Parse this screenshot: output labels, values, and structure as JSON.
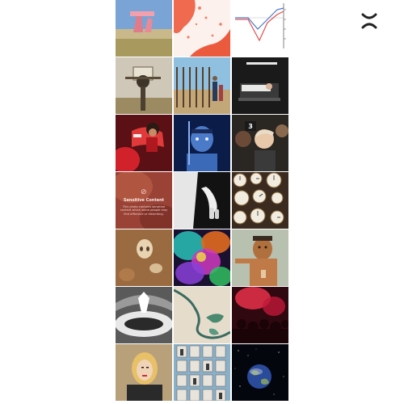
{
  "brand": {
    "logo_icon": "x-logo-icon"
  },
  "grid": {
    "sensitive_tile": {
      "icon": "eye-slash-icon",
      "title": "Sensitive Content",
      "description": "This photo contains sensitive content which some people may find offensive or disturbing."
    }
  }
}
